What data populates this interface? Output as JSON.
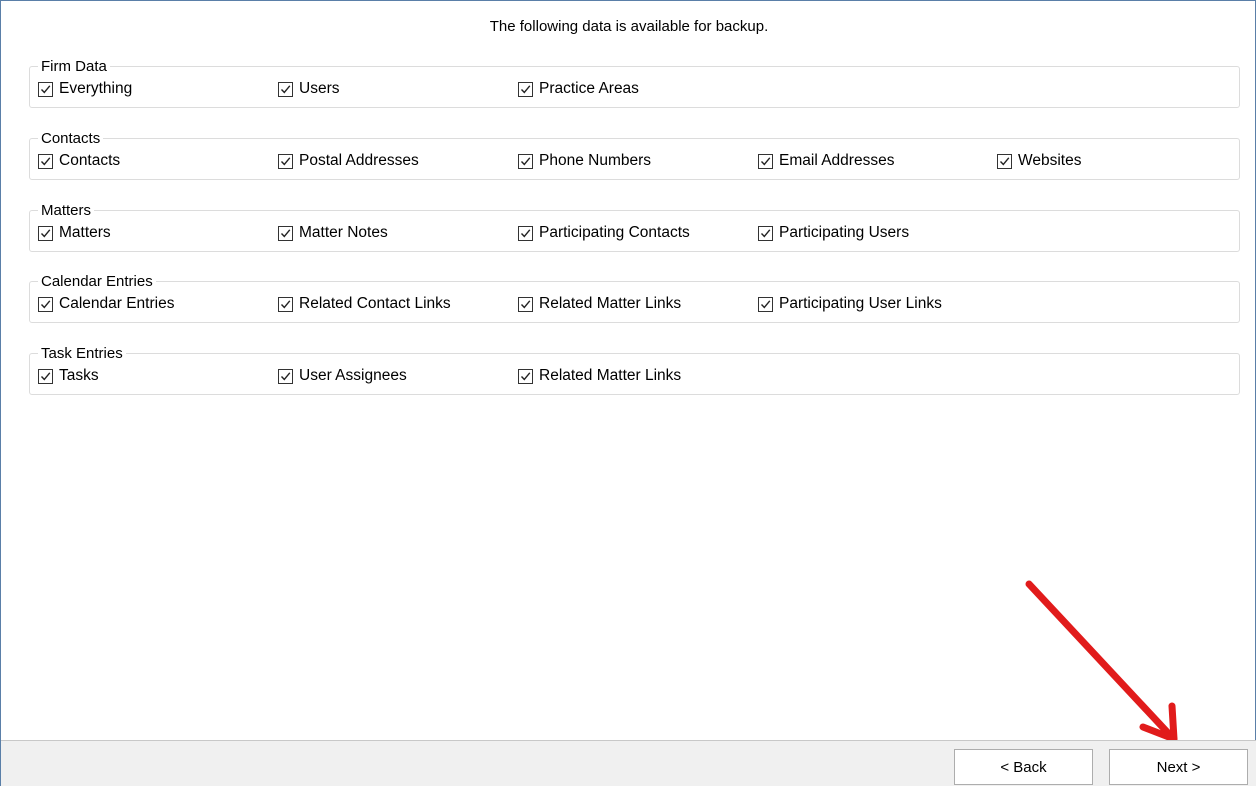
{
  "heading": "The following data is available for backup.",
  "groups": [
    {
      "title": "Firm Data",
      "items": [
        {
          "label": "Everything",
          "checked": true
        },
        {
          "label": "Users",
          "checked": true
        },
        {
          "label": "Practice Areas",
          "checked": true
        }
      ]
    },
    {
      "title": "Contacts",
      "items": [
        {
          "label": "Contacts",
          "checked": true
        },
        {
          "label": "Postal Addresses",
          "checked": true
        },
        {
          "label": "Phone Numbers",
          "checked": true
        },
        {
          "label": "Email Addresses",
          "checked": true
        },
        {
          "label": "Websites",
          "checked": true
        }
      ]
    },
    {
      "title": "Matters",
      "items": [
        {
          "label": "Matters",
          "checked": true
        },
        {
          "label": "Matter Notes",
          "checked": true
        },
        {
          "label": "Participating Contacts",
          "checked": true
        },
        {
          "label": "Participating Users",
          "checked": true
        }
      ]
    },
    {
      "title": "Calendar Entries",
      "items": [
        {
          "label": "Calendar Entries",
          "checked": true
        },
        {
          "label": "Related Contact Links",
          "checked": true
        },
        {
          "label": "Related Matter Links",
          "checked": true
        },
        {
          "label": "Participating User Links",
          "checked": true
        }
      ]
    },
    {
      "title": "Task Entries",
      "items": [
        {
          "label": "Tasks",
          "checked": true
        },
        {
          "label": "User Assignees",
          "checked": true
        },
        {
          "label": "Related Matter Links",
          "checked": true
        }
      ]
    }
  ],
  "footer": {
    "back_label": "< Back",
    "next_label": "Next >"
  },
  "annotation": {
    "arrow_color": "#e11b1b",
    "icon": "red-arrow-pointing-to-next"
  },
  "colors": {
    "footer_bg": "#f0f0f0",
    "group_border": "#dcdcdc"
  }
}
